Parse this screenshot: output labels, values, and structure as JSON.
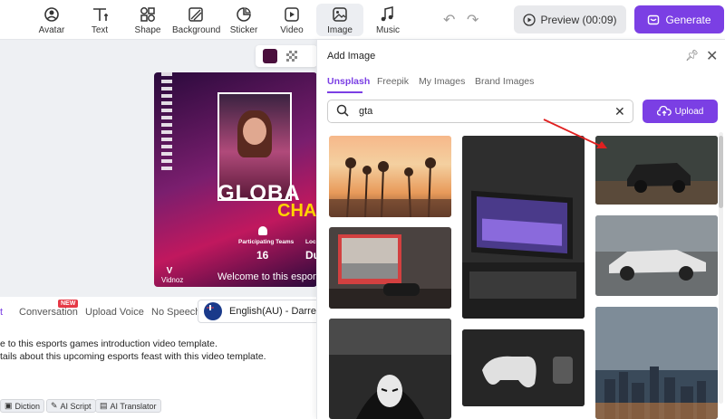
{
  "toolbar": {
    "tools": [
      {
        "label": "Avatar",
        "icon": "avatar-icon"
      },
      {
        "label": "Text",
        "icon": "text-icon"
      },
      {
        "label": "Shape",
        "icon": "shape-icon"
      },
      {
        "label": "Background",
        "icon": "background-icon"
      },
      {
        "label": "Sticker",
        "icon": "sticker-icon"
      },
      {
        "label": "Video",
        "icon": "video-icon"
      },
      {
        "label": "Image",
        "icon": "image-icon"
      },
      {
        "label": "Music",
        "icon": "music-icon"
      }
    ],
    "preview_label": "Preview (00:09)",
    "generate_label": "Generate"
  },
  "canvas": {
    "swatch_color": "#4a0f3c",
    "headline_line1": "GLOBA",
    "headline_line2": "CHA",
    "stat1_label": "Participating Teams",
    "stat1_value": "16",
    "stat2_label": "Loc",
    "stat2_value": "Du",
    "welcome_text": "Welcome to this esports",
    "logo_text": "Vidnoz"
  },
  "script": {
    "tabs": [
      {
        "label": "t"
      },
      {
        "label": "Conversation"
      },
      {
        "label": "Upload Voice"
      },
      {
        "label": "No Speech"
      }
    ],
    "new_badge": "NEW",
    "voice": "English(AU) - Darren",
    "line1": "e to this esports games introduction video template.",
    "line2": "tails about this upcoming esports feast with this video template.",
    "tools": [
      {
        "label": "Diction"
      },
      {
        "label": "AI Script"
      },
      {
        "label": "AI Translator"
      }
    ]
  },
  "panel": {
    "title": "Add Image",
    "tabs": [
      {
        "label": "Unsplash"
      },
      {
        "label": "Freepik"
      },
      {
        "label": "My Images"
      },
      {
        "label": "Brand Images"
      }
    ],
    "search_value": "gta",
    "upload_label": "Upload"
  },
  "colors": {
    "accent": "#7b3fe4",
    "annotation_arrow": "#e02020"
  }
}
